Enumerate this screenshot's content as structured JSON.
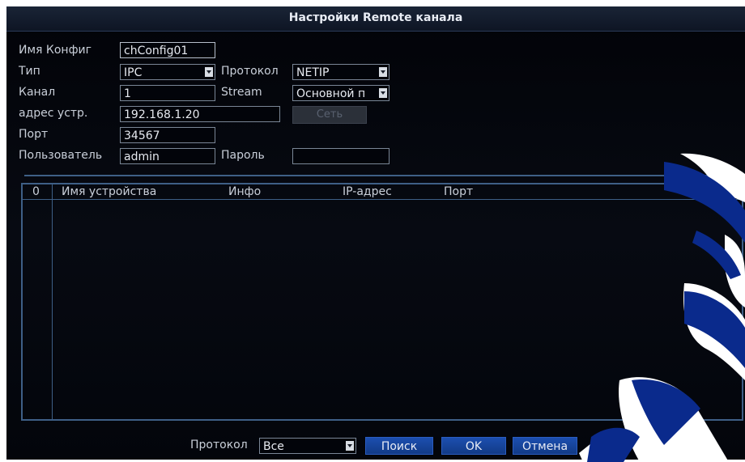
{
  "title": "Настройки Remote канала",
  "form": {
    "config_name_label": "Имя Конфиг",
    "config_name_value": "chConfig01",
    "type_label": "Тип",
    "type_value": "IPC",
    "protocol_label": "Протокол",
    "protocol_value": "NETIP",
    "channel_label": "Канал",
    "channel_value": "1",
    "stream_label": "Stream",
    "stream_value": "Основной п",
    "address_label": "адрес устр.",
    "address_value": "192.168.1.20",
    "net_button": "Сеть",
    "port_label": "Порт",
    "port_value": "34567",
    "user_label": "Пользователь",
    "user_value": "admin",
    "password_label": "Пароль",
    "password_value": ""
  },
  "device_list": {
    "columns": [
      "0",
      "Имя устройства",
      "Инфо",
      "IP-адрес",
      "Порт"
    ],
    "rows": []
  },
  "footer": {
    "protocol_label": "Протокол",
    "protocol_value": "Все",
    "search_button": "Поиск",
    "ok_button": "OK",
    "cancel_button": "Отмена"
  }
}
